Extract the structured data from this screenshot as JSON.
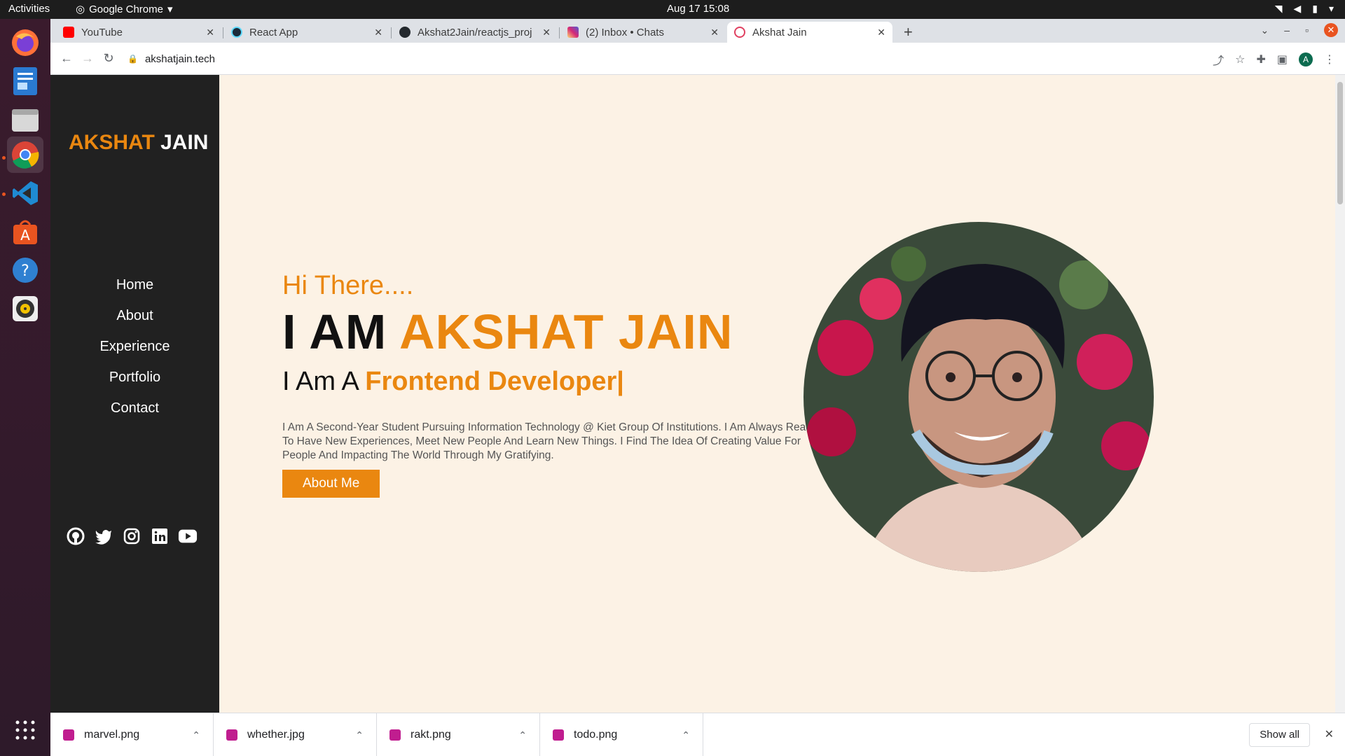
{
  "system": {
    "activities": "Activities",
    "app_name": "Google Chrome",
    "clock": "Aug 17  15:08"
  },
  "tabs": [
    {
      "title": "YouTube",
      "favicon_color": "#ff0000"
    },
    {
      "title": "React App",
      "favicon_color": "#61dafb"
    },
    {
      "title": "Akshat2Jain/reactjs_proj",
      "favicon_color": "#24292e"
    },
    {
      "title": "(2) Inbox • Chats",
      "favicon_color": "#d62976"
    },
    {
      "title": "Akshat Jain",
      "favicon_color": "#e04060",
      "active": true
    }
  ],
  "address_bar": {
    "url": "akshatjain.tech"
  },
  "profile_initial": "A",
  "site": {
    "brand_first": "AKSHAT",
    "brand_last": "JAIN",
    "nav": [
      "Home",
      "About",
      "Experience",
      "Portfolio",
      "Contact"
    ],
    "socials": [
      "github-icon",
      "twitter-icon",
      "instagram-icon",
      "linkedin-icon",
      "youtube-icon"
    ],
    "greeting": "Hi There....",
    "iam_prefix": "I AM",
    "name": "AKSHAT JAIN",
    "role_prefix": "I Am A",
    "role": "Frontend Developer|",
    "description": "I Am A Second-Year Student Pursuing Information Technology @ Kiet Group Of Institutions. I Am Always Ready To Have New Experiences, Meet New People And Learn New Things. I Find The Idea Of Creating Value For People And Impacting The World Through My Gratifying.",
    "cta": "About Me",
    "accent_color": "#ea8710"
  },
  "downloads": [
    {
      "name": "marvel.png"
    },
    {
      "name": "whether.jpg"
    },
    {
      "name": "rakt.png"
    },
    {
      "name": "todo.png"
    }
  ],
  "show_all": "Show all"
}
